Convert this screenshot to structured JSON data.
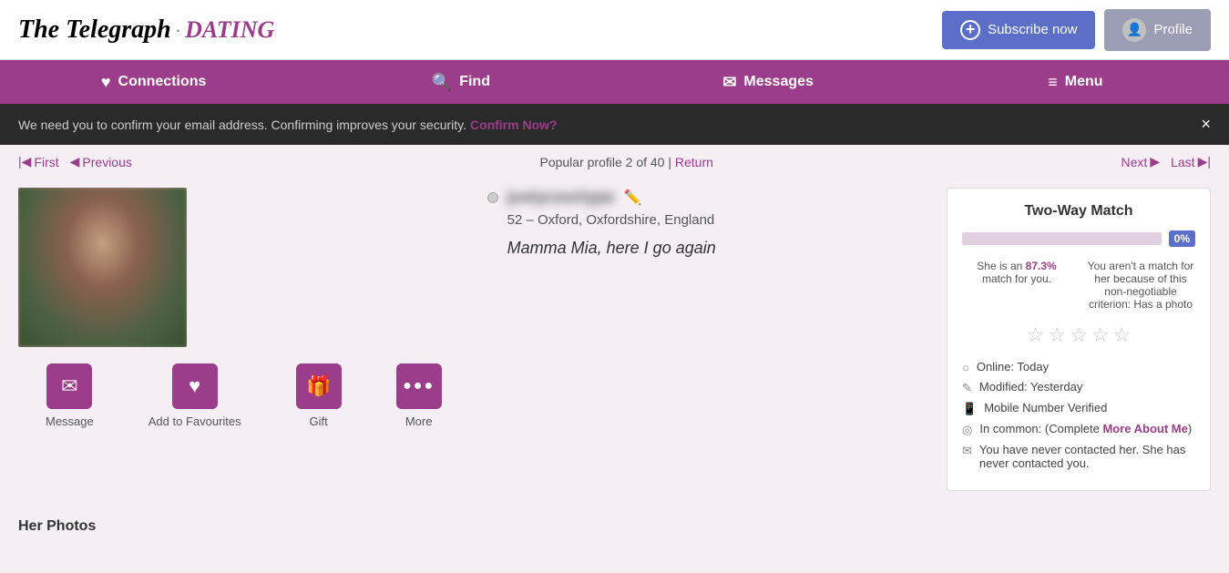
{
  "header": {
    "logo_telegraph": "The Telegraph",
    "logo_dot": "·",
    "logo_dating": "DATING",
    "subscribe_label": "Subscribe now",
    "profile_label": "Profile"
  },
  "nav": {
    "items": [
      {
        "id": "connections",
        "label": "Connections",
        "icon": "♥"
      },
      {
        "id": "find",
        "label": "Find",
        "icon": "🔍"
      },
      {
        "id": "messages",
        "label": "Messages",
        "icon": "✉"
      },
      {
        "id": "menu",
        "label": "Menu",
        "icon": "≡"
      }
    ]
  },
  "notification": {
    "text": "We need you to confirm your email address. Confirming improves your security.",
    "link_text": "Confirm Now?",
    "close_label": "×"
  },
  "pagination": {
    "first_label": "First",
    "previous_label": "Previous",
    "center_text": "Popular profile 2 of 40 |",
    "return_label": "Return",
    "next_label": "Next",
    "last_label": "Last"
  },
  "profile": {
    "name_blurred": "justycourtype",
    "age": "52",
    "location": "Oxford, Oxfordshire, England",
    "tagline": "Mamma Mia, here I go again",
    "actions": [
      {
        "id": "message",
        "label": "Message",
        "icon": "✉"
      },
      {
        "id": "favourites",
        "label": "Add to Favourites",
        "icon": "♥"
      },
      {
        "id": "gift",
        "label": "Gift",
        "icon": "🎁"
      },
      {
        "id": "more",
        "label": "More",
        "icon": "•••"
      }
    ]
  },
  "match": {
    "title": "Two-Way Match",
    "percent_label": "0%",
    "desc_left": "She is an 87.3% match for you.",
    "match_highlight": "87.3%",
    "desc_right": "You aren't a match for her because of this non-negotiable criterion: Has a photo",
    "stars": [
      "☆",
      "☆",
      "☆",
      "☆",
      "☆"
    ],
    "meta": [
      {
        "icon": "○",
        "text": "Online: Today"
      },
      {
        "icon": "✎",
        "text": "Modified: Yesterday"
      },
      {
        "icon": "□",
        "text": "Mobile Number Verified"
      },
      {
        "icon": "◎",
        "text_prefix": "In common:  (Complete ",
        "link": "More About Me",
        "text_suffix": ")"
      },
      {
        "icon": "✉",
        "text": "You have never contacted her. She has never contacted you."
      }
    ]
  },
  "her_photos": {
    "title": "Her Photos"
  }
}
